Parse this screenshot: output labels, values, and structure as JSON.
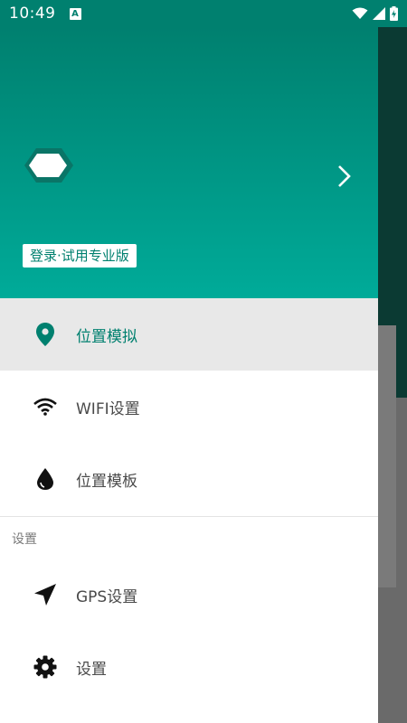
{
  "status_bar": {
    "time": "10:49",
    "indicator": "A",
    "icons": [
      "wifi-icon",
      "signal-icon",
      "battery-charging-icon"
    ]
  },
  "drawer": {
    "header": {
      "avatar_icon": "hexagon-avatar-icon",
      "login_label": "登录·试用专业版",
      "chevron_icon": "chevron-right-icon"
    },
    "items": [
      {
        "label": "位置模拟",
        "icon": "location-pin-icon",
        "active": true
      },
      {
        "label": "WIFI设置",
        "icon": "wifi-icon",
        "active": false
      },
      {
        "label": "位置模板",
        "icon": "water-drop-icon",
        "active": false
      }
    ],
    "section_title": "设置",
    "settings_items": [
      {
        "label": "GPS设置",
        "icon": "navigation-arrow-icon"
      },
      {
        "label": "设置",
        "icon": "gear-icon"
      }
    ]
  },
  "colors": {
    "primary": "#00806f",
    "primary_light": "#00ab99",
    "active_bg": "#e8e8e8"
  }
}
